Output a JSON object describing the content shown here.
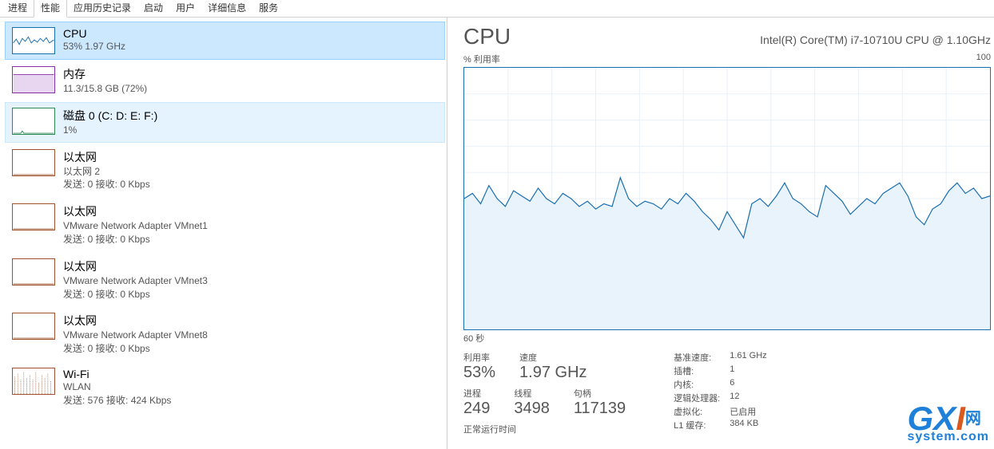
{
  "tabs": [
    "进程",
    "性能",
    "应用历史记录",
    "启动",
    "用户",
    "详细信息",
    "服务"
  ],
  "active_tab": 1,
  "sidebar": [
    {
      "kind": "cpu",
      "title": "CPU",
      "sub1": "53% 1.97 GHz",
      "sub2": "",
      "selected": true
    },
    {
      "kind": "mem",
      "title": "内存",
      "sub1": "11.3/15.8 GB (72%)",
      "sub2": ""
    },
    {
      "kind": "disk",
      "title": "磁盘 0 (C: D: E: F:)",
      "sub1": "1%",
      "sub2": "",
      "hover": true
    },
    {
      "kind": "net",
      "title": "以太网",
      "sub1": "以太网 2",
      "sub2": "发送: 0 接收: 0 Kbps"
    },
    {
      "kind": "net",
      "title": "以太网",
      "sub1": "VMware Network Adapter VMnet1",
      "sub2": "发送: 0 接收: 0 Kbps"
    },
    {
      "kind": "net",
      "title": "以太网",
      "sub1": "VMware Network Adapter VMnet3",
      "sub2": "发送: 0 接收: 0 Kbps"
    },
    {
      "kind": "net",
      "title": "以太网",
      "sub1": "VMware Network Adapter VMnet8",
      "sub2": "发送: 0 接收: 0 Kbps"
    },
    {
      "kind": "net",
      "title": "Wi-Fi",
      "sub1": "WLAN",
      "sub2": "发送: 576 接收: 424 Kbps"
    }
  ],
  "detail": {
    "title": "CPU",
    "cpu_name": "Intel(R) Core(TM) i7-10710U CPU @ 1.10GHz",
    "chart_top_left": "% 利用率",
    "chart_top_right": "100",
    "chart_bottom_left": "60 秒",
    "stats": [
      {
        "lbl": "利用率",
        "val": "53%"
      },
      {
        "lbl": "速度",
        "val": "1.97 GHz"
      },
      {
        "lbl": "进程",
        "val": "249"
      },
      {
        "lbl": "线程",
        "val": "3498"
      },
      {
        "lbl": "句柄",
        "val": "117139"
      }
    ],
    "kv": [
      [
        "基准速度:",
        "1.61 GHz"
      ],
      [
        "插槽:",
        "1"
      ],
      [
        "内核:",
        "6"
      ],
      [
        "逻辑处理器:",
        "12"
      ],
      [
        "虚拟化:",
        "已启用"
      ],
      [
        "L1 缓存:",
        "384 KB"
      ]
    ],
    "runtime_label": "正常运行时间"
  },
  "watermark": {
    "g": "G",
    "x": "X",
    "i": "I",
    "cn": "网",
    "sys": "system.com"
  },
  "chart_data": {
    "type": "area",
    "title": "CPU % 利用率",
    "xlabel": "60 秒",
    "ylabel": "% 利用率",
    "ylim": [
      0,
      100
    ],
    "x_seconds": 60,
    "values": [
      50,
      52,
      48,
      55,
      50,
      47,
      53,
      51,
      49,
      54,
      50,
      48,
      52,
      50,
      47,
      49,
      46,
      48,
      47,
      58,
      50,
      47,
      49,
      48,
      46,
      50,
      48,
      52,
      49,
      45,
      42,
      38,
      45,
      40,
      35,
      48,
      50,
      47,
      51,
      56,
      50,
      48,
      45,
      43,
      55,
      52,
      49,
      44,
      47,
      50,
      48,
      52,
      54,
      56,
      51,
      43,
      40,
      46,
      48,
      53,
      56,
      52,
      54,
      50,
      51
    ]
  }
}
